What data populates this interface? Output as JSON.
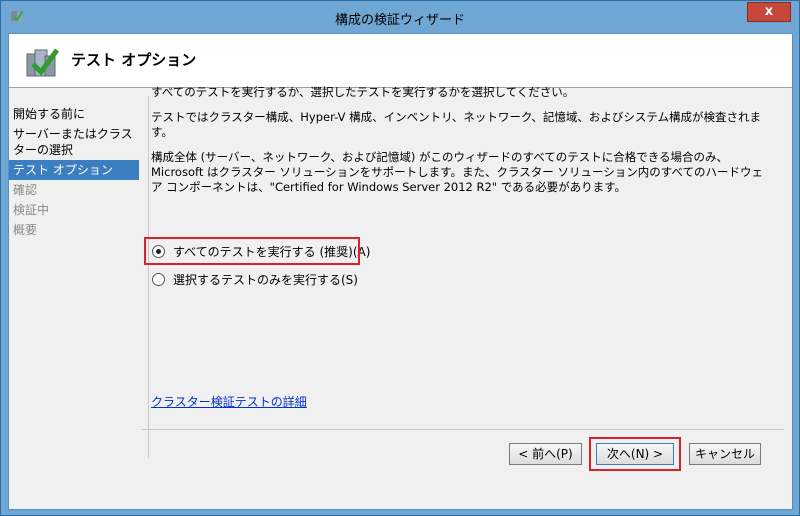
{
  "window": {
    "title": "構成の検証ウィザード",
    "close_label": "x"
  },
  "header": {
    "title": "テスト オプション"
  },
  "nav": {
    "items": [
      {
        "label": "開始する前に",
        "state": "normal"
      },
      {
        "label": "サーバーまたはクラスターの選択",
        "state": "normal"
      },
      {
        "label": "テスト オプション",
        "state": "active"
      },
      {
        "label": "確認",
        "state": "disabled"
      },
      {
        "label": "検証中",
        "state": "disabled"
      },
      {
        "label": "概要",
        "state": "disabled"
      }
    ]
  },
  "content": {
    "line1": "すべてのテストを実行するか、選択したテストを実行するかを選択してください。",
    "line2": "テストではクラスター構成、Hyper-V 構成、インベントリ、ネットワーク、記憶域、およびシステム構成が検査されます。",
    "line3": "構成全体 (サーバー、ネットワーク、および記憶域) がこのウィザードのすべてのテストに合格できる場合のみ、Microsoft はクラスター ソリューションをサポートします。また、クラスター ソリューション内のすべてのハードウェア コンポーネントは、\"Certified for Windows Server 2012 R2\" である必要があります。"
  },
  "options": {
    "run_all": "すべてのテストを実行する (推奨)(A)",
    "run_selected": "選択するテストのみを実行する(S)",
    "selected": "run_all"
  },
  "link": "クラスター検証テストの詳細",
  "buttons": {
    "prev": "< 前へ(P)",
    "next": "次へ(N) >",
    "cancel": "キャンセル"
  },
  "colors": {
    "highlight": "#d8232a",
    "nav_active": "#3c7fc1",
    "titlebar": "#6fa6d4"
  }
}
